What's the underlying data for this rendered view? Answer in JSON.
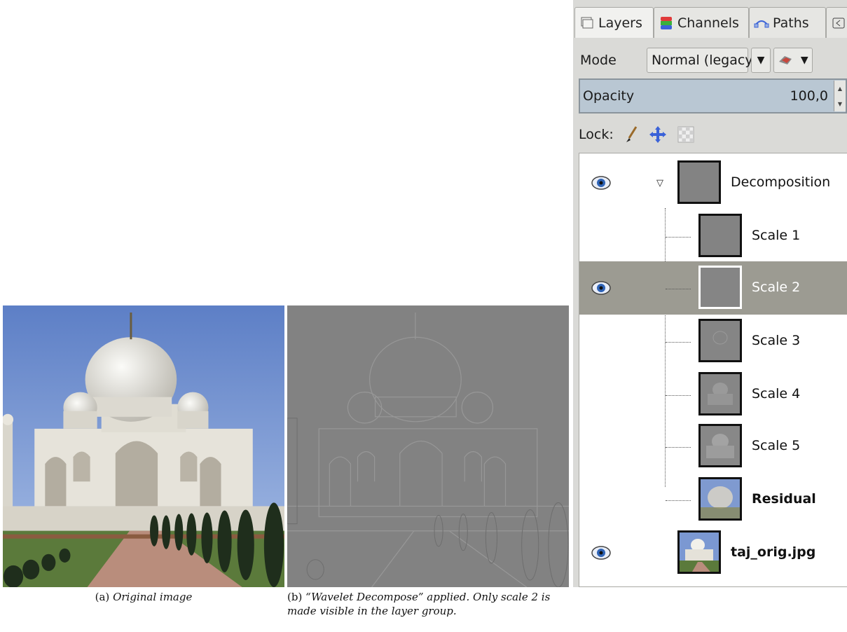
{
  "figures": {
    "a": {
      "label": "(a)",
      "caption": "Original image"
    },
    "b": {
      "label": "(b)",
      "caption": "“Wavelet Decompose” applied.  Only scale 2 is made visible in the layer group."
    }
  },
  "dock": {
    "tabs": [
      {
        "label": "Layers",
        "icon": "layers-icon"
      },
      {
        "label": "Channels",
        "icon": "channels-icon"
      },
      {
        "label": "Paths",
        "icon": "paths-icon"
      }
    ],
    "mode_label": "Mode",
    "mode_value": "Normal (legacy)",
    "opacity_label": "Opacity",
    "opacity_value": "100,0",
    "lock_label": "Lock:",
    "layers": [
      {
        "name": "Decomposition",
        "visible": true,
        "group": true,
        "expanded": true
      },
      {
        "name": "Scale 1",
        "visible": false
      },
      {
        "name": "Scale 2",
        "visible": true,
        "selected": true
      },
      {
        "name": "Scale 3",
        "visible": false
      },
      {
        "name": "Scale 4",
        "visible": false
      },
      {
        "name": "Scale 5",
        "visible": false
      },
      {
        "name": "Residual",
        "visible": false,
        "bold": true
      },
      {
        "name": "taj_orig.jpg",
        "visible": true,
        "bold": true
      }
    ]
  },
  "colors": {
    "sky": "#6f8fd0",
    "selected_row": "#9c9b92",
    "opacity_bg": "#b9c7d3",
    "eye_blue": "#2f64b7"
  }
}
